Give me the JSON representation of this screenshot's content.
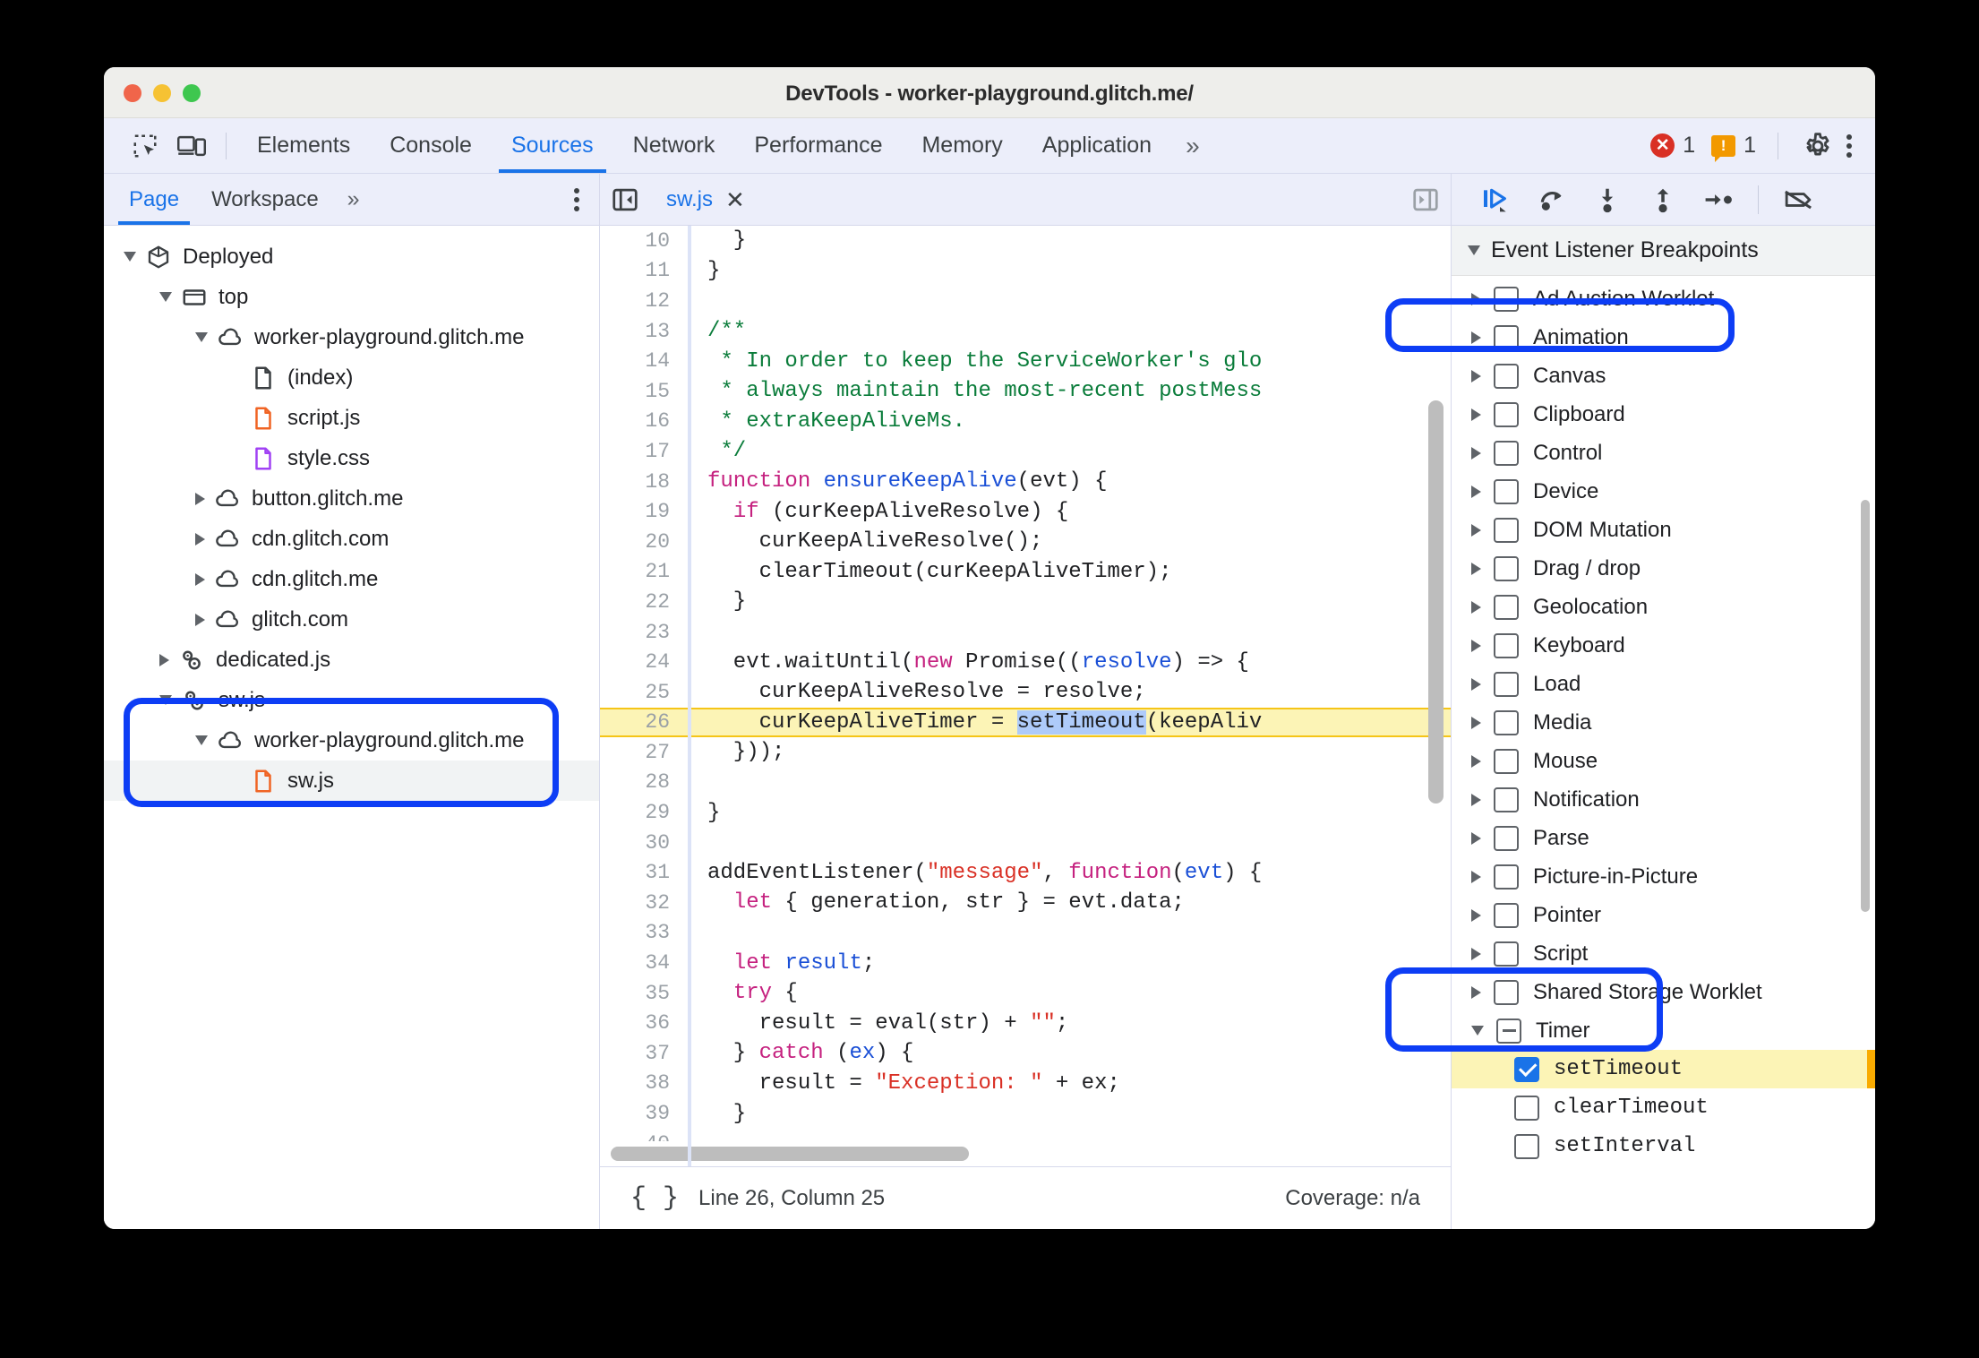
{
  "window": {
    "title": "DevTools - worker-playground.glitch.me/",
    "traffic_lights": [
      "close-red",
      "minimize-yellow",
      "maximize-green"
    ]
  },
  "main_tabs": {
    "icons": [
      "inspect-element-icon",
      "device-toolbar-icon"
    ],
    "items": [
      {
        "label": "Elements",
        "active": false
      },
      {
        "label": "Console",
        "active": false
      },
      {
        "label": "Sources",
        "active": true
      },
      {
        "label": "Network",
        "active": false
      },
      {
        "label": "Performance",
        "active": false
      },
      {
        "label": "Memory",
        "active": false
      },
      {
        "label": "Application",
        "active": false
      }
    ],
    "overflow_label": "»",
    "error_count": "1",
    "warning_count": "1",
    "settings_icon": "gear-icon",
    "more_icon": "kebab-menu-icon"
  },
  "navigator": {
    "tabs": [
      {
        "label": "Page",
        "active": true
      },
      {
        "label": "Workspace",
        "active": false
      }
    ],
    "overflow_label": "»",
    "tree": [
      {
        "label": "Deployed",
        "indent": 0,
        "arrow": "open",
        "icon": "cube-icon"
      },
      {
        "label": "top",
        "indent": 1,
        "arrow": "open",
        "icon": "frame-icon"
      },
      {
        "label": "worker-playground.glitch.me",
        "indent": 2,
        "arrow": "open",
        "icon": "cloud-icon"
      },
      {
        "label": "(index)",
        "indent": 3,
        "arrow": "none",
        "icon": "document-icon"
      },
      {
        "label": "script.js",
        "indent": 3,
        "arrow": "none",
        "icon": "js-file-icon"
      },
      {
        "label": "style.css",
        "indent": 3,
        "arrow": "none",
        "icon": "css-file-icon"
      },
      {
        "label": "button.glitch.me",
        "indent": 2,
        "arrow": "closed",
        "icon": "cloud-icon"
      },
      {
        "label": "cdn.glitch.com",
        "indent": 2,
        "arrow": "closed",
        "icon": "cloud-icon"
      },
      {
        "label": "cdn.glitch.me",
        "indent": 2,
        "arrow": "closed",
        "icon": "cloud-icon"
      },
      {
        "label": "glitch.com",
        "indent": 2,
        "arrow": "closed",
        "icon": "cloud-icon"
      },
      {
        "label": "dedicated.js",
        "indent": 1,
        "arrow": "closed",
        "icon": "worker-gears-icon"
      },
      {
        "label": "sw.js",
        "indent": 1,
        "arrow": "open",
        "icon": "worker-gears-icon"
      },
      {
        "label": "worker-playground.glitch.me",
        "indent": 2,
        "arrow": "open",
        "icon": "cloud-icon"
      },
      {
        "label": "sw.js",
        "indent": 3,
        "arrow": "none",
        "icon": "js-file-icon",
        "selected": true
      }
    ]
  },
  "editor": {
    "collapse_icon": "collapse-sidebar-icon",
    "expand_icon": "expand-sidebar-icon",
    "tab_name": "sw.js",
    "close_label": "✕",
    "highlight_line": 26,
    "lines": [
      {
        "n": 10,
        "tokens": [
          {
            "t": "  }"
          }
        ]
      },
      {
        "n": 11,
        "tokens": [
          {
            "t": "}"
          }
        ]
      },
      {
        "n": 12,
        "tokens": [
          {
            "t": ""
          }
        ]
      },
      {
        "n": 13,
        "tokens": [
          {
            "t": "/**",
            "c": "cm"
          }
        ]
      },
      {
        "n": 14,
        "tokens": [
          {
            "t": " * In order to keep the ServiceWorker's glo",
            "c": "cm"
          }
        ]
      },
      {
        "n": 15,
        "tokens": [
          {
            "t": " * always maintain the most-recent postMess",
            "c": "cm"
          }
        ]
      },
      {
        "n": 16,
        "tokens": [
          {
            "t": " * extraKeepAliveMs.",
            "c": "cm"
          }
        ]
      },
      {
        "n": 17,
        "tokens": [
          {
            "t": " */",
            "c": "cm"
          }
        ]
      },
      {
        "n": 18,
        "tokens": [
          {
            "t": "function ",
            "c": "k"
          },
          {
            "t": "ensureKeepAlive",
            "c": "fn"
          },
          {
            "t": "(evt) {"
          }
        ]
      },
      {
        "n": 19,
        "tokens": [
          {
            "t": "  "
          },
          {
            "t": "if",
            "c": "k"
          },
          {
            "t": " (curKeepAliveResolve) {"
          }
        ]
      },
      {
        "n": 20,
        "tokens": [
          {
            "t": "    curKeepAliveResolve();"
          }
        ]
      },
      {
        "n": 21,
        "tokens": [
          {
            "t": "    clearTimeout(curKeepAliveTimer);"
          }
        ]
      },
      {
        "n": 22,
        "tokens": [
          {
            "t": "  }"
          }
        ]
      },
      {
        "n": 23,
        "tokens": [
          {
            "t": ""
          }
        ]
      },
      {
        "n": 24,
        "tokens": [
          {
            "t": "  evt.waitUntil("
          },
          {
            "t": "new",
            "c": "k"
          },
          {
            "t": " Promise(("
          },
          {
            "t": "resolve",
            "c": "fn"
          },
          {
            "t": ") => {"
          }
        ]
      },
      {
        "n": 25,
        "tokens": [
          {
            "t": "    curKeepAliveResolve = resolve;"
          }
        ]
      },
      {
        "n": 26,
        "tokens": [
          {
            "t": "    curKeepAliveTimer = "
          },
          {
            "t": "setTimeout",
            "c": "sel"
          },
          {
            "t": "(keepAliv"
          }
        ],
        "hl": true
      },
      {
        "n": 27,
        "tokens": [
          {
            "t": "  }));"
          }
        ]
      },
      {
        "n": 28,
        "tokens": [
          {
            "t": ""
          }
        ]
      },
      {
        "n": 29,
        "tokens": [
          {
            "t": "}"
          }
        ]
      },
      {
        "n": 30,
        "tokens": [
          {
            "t": ""
          }
        ]
      },
      {
        "n": 31,
        "tokens": [
          {
            "t": "addEventListener("
          },
          {
            "t": "\"message\"",
            "c": "st"
          },
          {
            "t": ", "
          },
          {
            "t": "function",
            "c": "k"
          },
          {
            "t": "("
          },
          {
            "t": "evt",
            "c": "fn"
          },
          {
            "t": ") {"
          }
        ]
      },
      {
        "n": 32,
        "tokens": [
          {
            "t": "  "
          },
          {
            "t": "let",
            "c": "k"
          },
          {
            "t": " { generation, str } = evt.data;"
          }
        ]
      },
      {
        "n": 33,
        "tokens": [
          {
            "t": ""
          }
        ]
      },
      {
        "n": 34,
        "tokens": [
          {
            "t": "  "
          },
          {
            "t": "let",
            "c": "k"
          },
          {
            "t": " "
          },
          {
            "t": "result",
            "c": "fn"
          },
          {
            "t": ";"
          }
        ]
      },
      {
        "n": 35,
        "tokens": [
          {
            "t": "  "
          },
          {
            "t": "try",
            "c": "k"
          },
          {
            "t": " {"
          }
        ]
      },
      {
        "n": 36,
        "tokens": [
          {
            "t": "    result = eval(str) + "
          },
          {
            "t": "\"\"",
            "c": "st"
          },
          {
            "t": ";"
          }
        ]
      },
      {
        "n": 37,
        "tokens": [
          {
            "t": "  } "
          },
          {
            "t": "catch",
            "c": "k"
          },
          {
            "t": " ("
          },
          {
            "t": "ex",
            "c": "fn"
          },
          {
            "t": ") {"
          }
        ]
      },
      {
        "n": 38,
        "tokens": [
          {
            "t": "    result = "
          },
          {
            "t": "\"Exception: \"",
            "c": "st"
          },
          {
            "t": " + ex;"
          }
        ]
      },
      {
        "n": 39,
        "tokens": [
          {
            "t": "  }"
          }
        ]
      },
      {
        "n": 40,
        "tokens": [
          {
            "t": ""
          }
        ]
      }
    ],
    "status": {
      "pretty_print_icon": "{ }",
      "position": "Line 26, Column 25",
      "coverage": "Coverage: n/a"
    }
  },
  "debugger": {
    "toolbar": [
      {
        "icon": "resume-script-icon",
        "accent": "#1a73e8"
      },
      {
        "icon": "step-over-icon"
      },
      {
        "icon": "step-into-icon"
      },
      {
        "icon": "step-out-icon"
      },
      {
        "icon": "step-icon"
      },
      {
        "icon": "deactivate-breakpoints-icon"
      }
    ],
    "section_title": "Event Listener Breakpoints",
    "section_expanded": true,
    "items": [
      {
        "label": "Ad Auction Worklet",
        "state": "unchecked",
        "expanded": false
      },
      {
        "label": "Animation",
        "state": "unchecked",
        "expanded": false
      },
      {
        "label": "Canvas",
        "state": "unchecked",
        "expanded": false
      },
      {
        "label": "Clipboard",
        "state": "unchecked",
        "expanded": false
      },
      {
        "label": "Control",
        "state": "unchecked",
        "expanded": false
      },
      {
        "label": "Device",
        "state": "unchecked",
        "expanded": false
      },
      {
        "label": "DOM Mutation",
        "state": "unchecked",
        "expanded": false
      },
      {
        "label": "Drag / drop",
        "state": "unchecked",
        "expanded": false
      },
      {
        "label": "Geolocation",
        "state": "unchecked",
        "expanded": false
      },
      {
        "label": "Keyboard",
        "state": "unchecked",
        "expanded": false
      },
      {
        "label": "Load",
        "state": "unchecked",
        "expanded": false
      },
      {
        "label": "Media",
        "state": "unchecked",
        "expanded": false
      },
      {
        "label": "Mouse",
        "state": "unchecked",
        "expanded": false
      },
      {
        "label": "Notification",
        "state": "unchecked",
        "expanded": false
      },
      {
        "label": "Parse",
        "state": "unchecked",
        "expanded": false
      },
      {
        "label": "Picture-in-Picture",
        "state": "unchecked",
        "expanded": false
      },
      {
        "label": "Pointer",
        "state": "unchecked",
        "expanded": false
      },
      {
        "label": "Script",
        "state": "unchecked",
        "expanded": false
      },
      {
        "label": "Shared Storage Worklet",
        "state": "unchecked",
        "expanded": false
      },
      {
        "label": "Timer",
        "state": "indeterminate",
        "expanded": true
      },
      {
        "label": "setTimeout",
        "state": "checked",
        "child": true,
        "highlighted": true
      },
      {
        "label": "clearTimeout",
        "state": "unchecked",
        "child": true
      },
      {
        "label": "setInterval",
        "state": "unchecked",
        "child": true
      }
    ]
  },
  "annotations": {
    "color": "#0d3df5",
    "regions": [
      "sw-js-worker-group",
      "event-listener-breakpoints-header",
      "timer-settimeout-breakpoint"
    ]
  }
}
